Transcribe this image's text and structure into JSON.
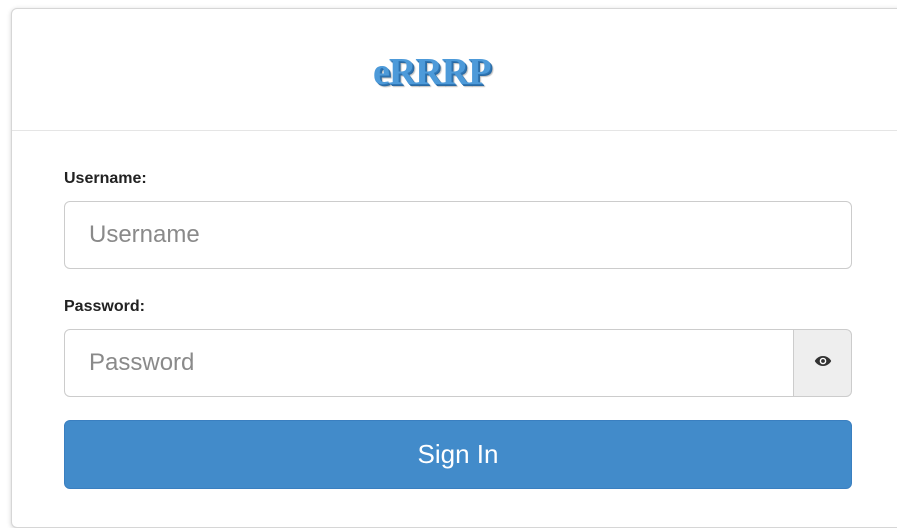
{
  "header": {
    "logo_text": "eRRRP"
  },
  "form": {
    "username": {
      "label": "Username:",
      "placeholder": "Username",
      "value": ""
    },
    "password": {
      "label": "Password:",
      "placeholder": "Password",
      "value": "",
      "toggle_icon": "eye-icon"
    },
    "submit_label": "Sign In"
  },
  "colors": {
    "primary": "#428bca",
    "logo": "#4d9ad9",
    "toggle_bg": "#eeeeee"
  }
}
